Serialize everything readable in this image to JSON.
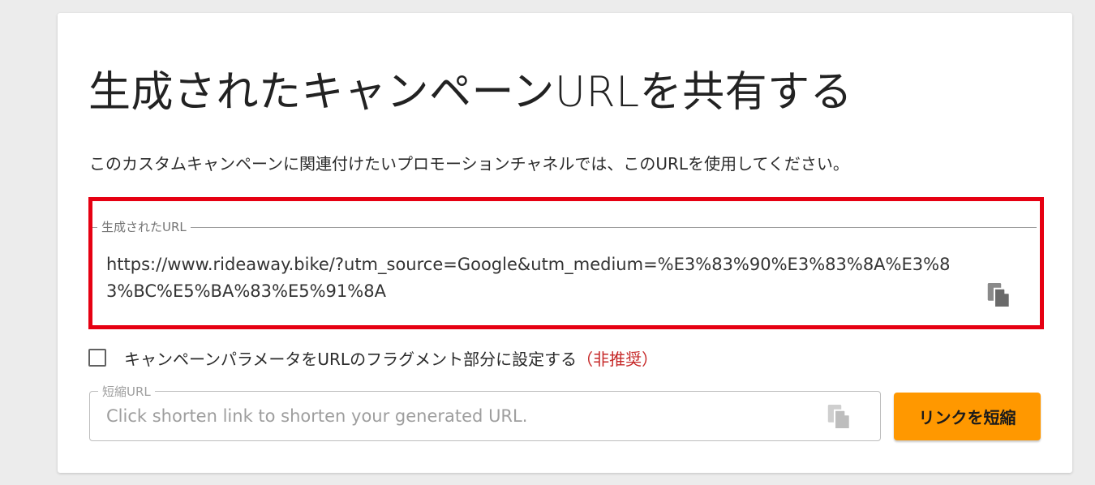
{
  "page": {
    "title": "生成されたキャンペーンURLを共有する",
    "description": "このカスタムキャンペーンに関連付けたいプロモーションチャネルでは、このURLを使用してください。"
  },
  "generated_url": {
    "label": "生成されたURL",
    "value": "https://www.rideaway.bike/?utm_source=Google&utm_medium=%E3%83%90%E3%83%8A%E3%83%BC%E5%BA%83%E5%91%8A",
    "copy_icon": "copy-icon"
  },
  "fragment_option": {
    "label": "キャンペーンパラメータをURLのフラグメント部分に設定する",
    "deprecated_note": "（非推奨）",
    "checked": false
  },
  "short_url": {
    "label": "短縮URL",
    "placeholder": "Click shorten link to shorten your generated URL.",
    "value": "",
    "copy_icon": "copy-icon"
  },
  "shorten_button": {
    "label": "リンクを短縮"
  },
  "colors": {
    "highlight_border": "#e60012",
    "button_background": "#ff9800",
    "deprecated_text": "#c62828"
  }
}
